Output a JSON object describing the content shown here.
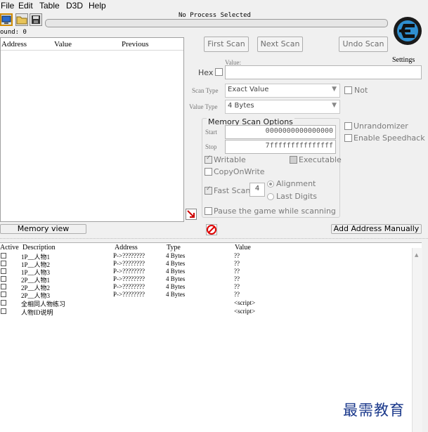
{
  "menu": {
    "file": "File",
    "edit": "Edit",
    "table": "Table",
    "d3d": "D3D",
    "help": "Help"
  },
  "process": {
    "title": "No Process Selected"
  },
  "found": {
    "label": "ound: 0"
  },
  "logo": {
    "settings": "Settings",
    "brand": "Cheat Engine"
  },
  "results_table": {
    "headers": {
      "address": "Address",
      "value": "Value",
      "previous": "Previous"
    }
  },
  "scan": {
    "first": "First Scan",
    "next": "Next Scan",
    "undo": "Undo Scan",
    "value_label": "Value:",
    "hex": "Hex",
    "scan_type_label": "Scan Type",
    "scan_type": "Exact Value",
    "value_type_label": "Value Type",
    "value_type": "4 Bytes",
    "not": "Not"
  },
  "memory_options": {
    "title": "Memory Scan Options",
    "start_label": "Start",
    "start": "0000000000000000",
    "stop_label": "Stop",
    "stop": "7fffffffffffffff",
    "writable": "Writable",
    "executable": "Executable",
    "copy_on_write": "CopyOnWrite",
    "fast_scan": "Fast Scan",
    "fast_value": "4",
    "alignment": "Alignment",
    "last_digits": "Last Digits",
    "pause": "Pause the game while scanning"
  },
  "right_opts": {
    "unrandomizer": "Unrandomizer",
    "speedhack": "Enable Speedhack"
  },
  "bottom_bar": {
    "memory_view": "Memory view",
    "add_manually": "Add Address Manually"
  },
  "cheat_table": {
    "headers": {
      "active": "Active",
      "description": "Description",
      "address": "Address",
      "type": "Type",
      "value": "Value"
    },
    "rows": [
      {
        "desc": "1P__人物1",
        "address": "P->????????",
        "type": "4 Bytes",
        "value": "??"
      },
      {
        "desc": "1P__人物2",
        "address": "P->????????",
        "type": "4 Bytes",
        "value": "??"
      },
      {
        "desc": "1P__人物3",
        "address": "P->????????",
        "type": "4 Bytes",
        "value": "??"
      },
      {
        "desc": "2P__人物1",
        "address": "P->????????",
        "type": "4 Bytes",
        "value": "??"
      },
      {
        "desc": "2P__人物2",
        "address": "P->????????",
        "type": "4 Bytes",
        "value": "??"
      },
      {
        "desc": "2P__人物3",
        "address": "P->????????",
        "type": "4 Bytes",
        "value": "??"
      },
      {
        "desc": "全相同人物练习",
        "address": "",
        "type": "",
        "value": "<script>"
      },
      {
        "desc": "人物ID说明",
        "address": "",
        "type": "",
        "value": "<script>"
      }
    ]
  },
  "watermark": "最需教育"
}
